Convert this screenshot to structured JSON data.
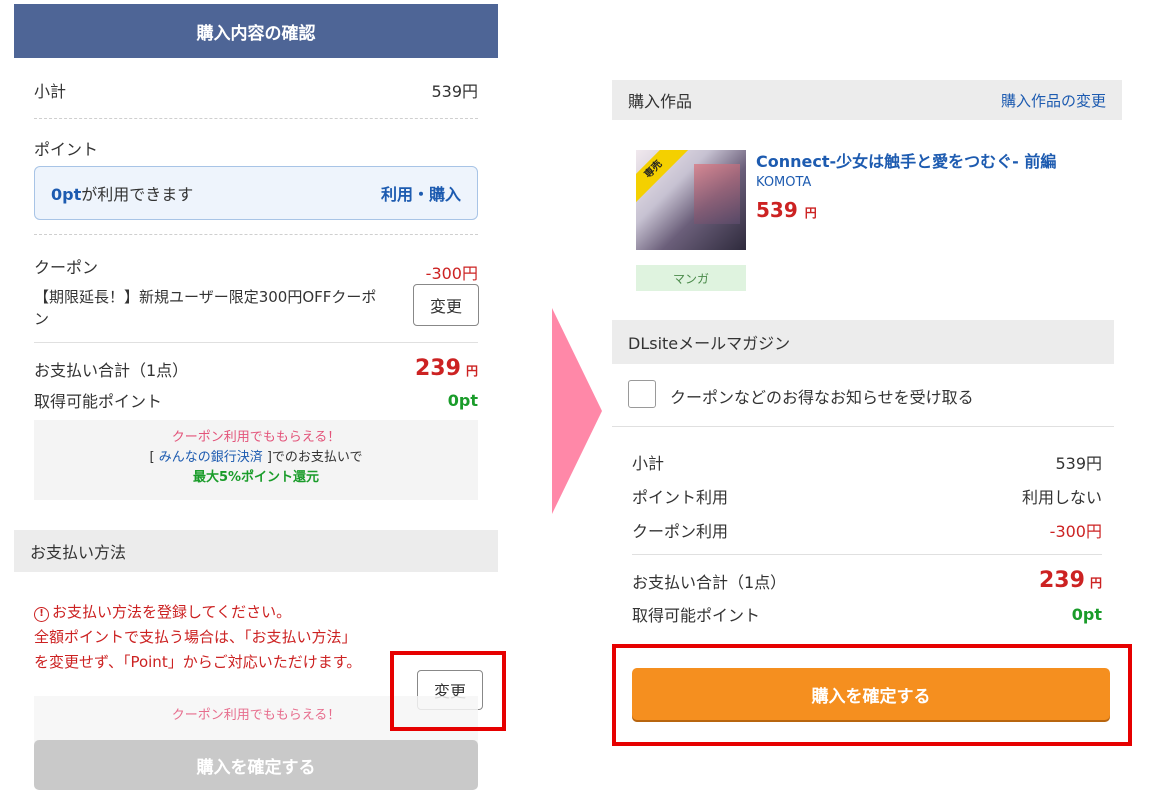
{
  "left": {
    "header_title": "購入内容の確認",
    "subtotal_label": "小計",
    "subtotal_value": "539円",
    "points_label": "ポイント",
    "points_available_amount": "0pt",
    "points_available_text": "が利用できます",
    "points_action": "利用・購入",
    "coupon_label": "クーポン",
    "coupon_value": "-300円",
    "coupon_name": "【期限延長！】新規ユーザー限定300円OFFクーポン",
    "coupon_change": "変更",
    "total_label": "お支払い合計（1点）",
    "total_value": "239",
    "total_unit": "円",
    "earn_label": "取得可能ポイント",
    "earn_value": "0pt",
    "promo_line1": "クーポン利用でももらえる！",
    "promo_line2_pre": "[",
    "promo_line2_link": "みんなの銀行決済",
    "promo_line2_post": "]でのお支払いで",
    "promo_line3": "最大5%ポイント還元",
    "payment_section": "お支払い方法",
    "warn_icon": "!",
    "warn_line1": "お支払い方法を登録してください。",
    "warn_line2": "全額ポイントで支払う場合は、「お支払い方法」",
    "warn_line3": "を変更せず、「Point」からご対応いただけます。",
    "payment_change": "変更",
    "fade_promo": "クーポン利用でももらえる！",
    "confirm_label": "購入を確定する"
  },
  "right": {
    "items_section": "購入作品",
    "items_change_link": "購入作品の変更",
    "ribbon": "専売",
    "item_title": "Connect-少女は触手と愛をつむぐ- 前編",
    "item_maker": "KOMOTA",
    "item_price": "539",
    "item_price_unit": "円",
    "genre": "マンガ",
    "mail_section": "DLsiteメールマガジン",
    "mail_checkbox_label": "クーポンなどのお得なお知らせを受け取る",
    "subtotal_label": "小計",
    "subtotal_value": "539円",
    "points_use_label": "ポイント利用",
    "points_use_value": "利用しない",
    "coupon_use_label": "クーポン利用",
    "coupon_use_value": "-300円",
    "total_label": "お支払い合計（1点）",
    "total_value": "239",
    "total_unit": "円",
    "earn_label": "取得可能ポイント",
    "earn_value": "0pt",
    "confirm_label": "購入を確定する"
  },
  "colors": {
    "header_bg": "#4e6596",
    "accent_blue": "#1d5bb0",
    "price_red": "#cc2222",
    "points_green": "#1a9c2a",
    "confirm_orange": "#f58f1f",
    "highlight_frame": "#e60000",
    "arrow_pink": "#ff88a8"
  }
}
